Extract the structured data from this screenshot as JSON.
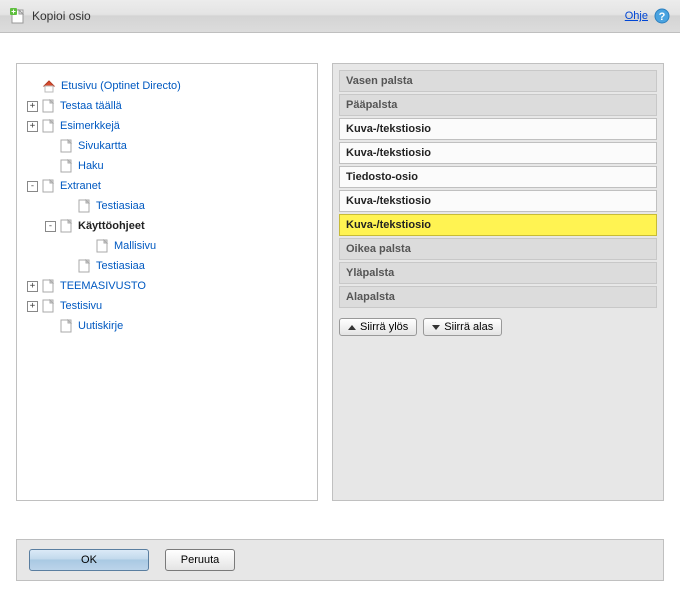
{
  "title": "Kopioi osio",
  "help": {
    "label": "Ohje"
  },
  "tree": {
    "root": "Etusivu (Optinet Directo)",
    "items": [
      {
        "label": "Testaa täällä"
      },
      {
        "label": "Esimerkkejä"
      },
      {
        "label": "Sivukartta"
      },
      {
        "label": "Haku"
      },
      {
        "label": "Extranet"
      },
      {
        "label": "Testiasiaa"
      },
      {
        "label": "Käyttöohjeet"
      },
      {
        "label": "Mallisivu"
      },
      {
        "label": "Testiasiaa"
      },
      {
        "label": "TEEMASIVUSTO"
      },
      {
        "label": "Testisivu"
      },
      {
        "label": "Uutiskirje"
      }
    ]
  },
  "right": {
    "headers": {
      "vasen": "Vasen palsta",
      "paa": "Pääpalsta",
      "oikea": "Oikea palsta",
      "yla": "Yläpalsta",
      "ala": "Alapalsta"
    },
    "items": {
      "kt1": "Kuva-/tekstiosio",
      "kt2": "Kuva-/tekstiosio",
      "tied": "Tiedosto-osio",
      "kt3": "Kuva-/tekstiosio",
      "kt4": "Kuva-/tekstiosio"
    },
    "buttons": {
      "up": "Siirrä ylös",
      "down": "Siirrä alas"
    }
  },
  "footer": {
    "ok": "OK",
    "cancel": "Peruuta"
  }
}
